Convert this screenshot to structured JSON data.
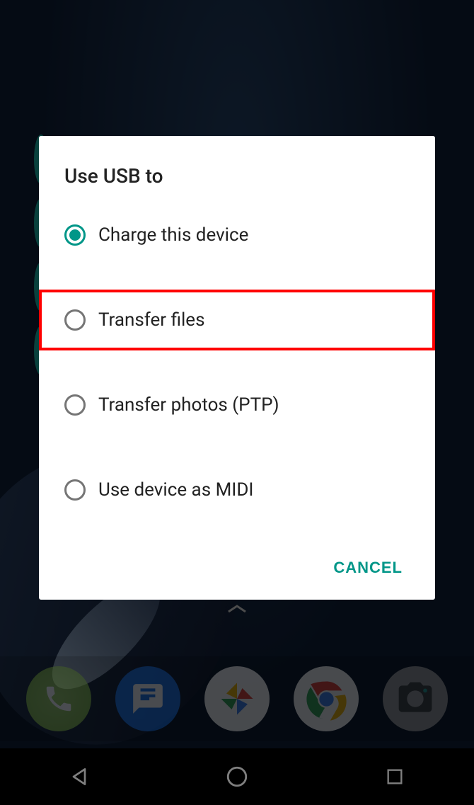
{
  "dialog": {
    "title": "Use USB to",
    "options": [
      {
        "label": "Charge this device",
        "selected": true,
        "highlighted": false
      },
      {
        "label": "Transfer files",
        "selected": false,
        "highlighted": true
      },
      {
        "label": "Transfer photos (PTP)",
        "selected": false,
        "highlighted": false
      },
      {
        "label": "Use device as MIDI",
        "selected": false,
        "highlighted": false
      }
    ],
    "cancel_label": "CANCEL"
  },
  "colors": {
    "accent": "#009688",
    "highlight_box": "#ff0000"
  },
  "dock": {
    "apps": [
      "phone",
      "messages",
      "photos",
      "chrome",
      "camera"
    ]
  }
}
